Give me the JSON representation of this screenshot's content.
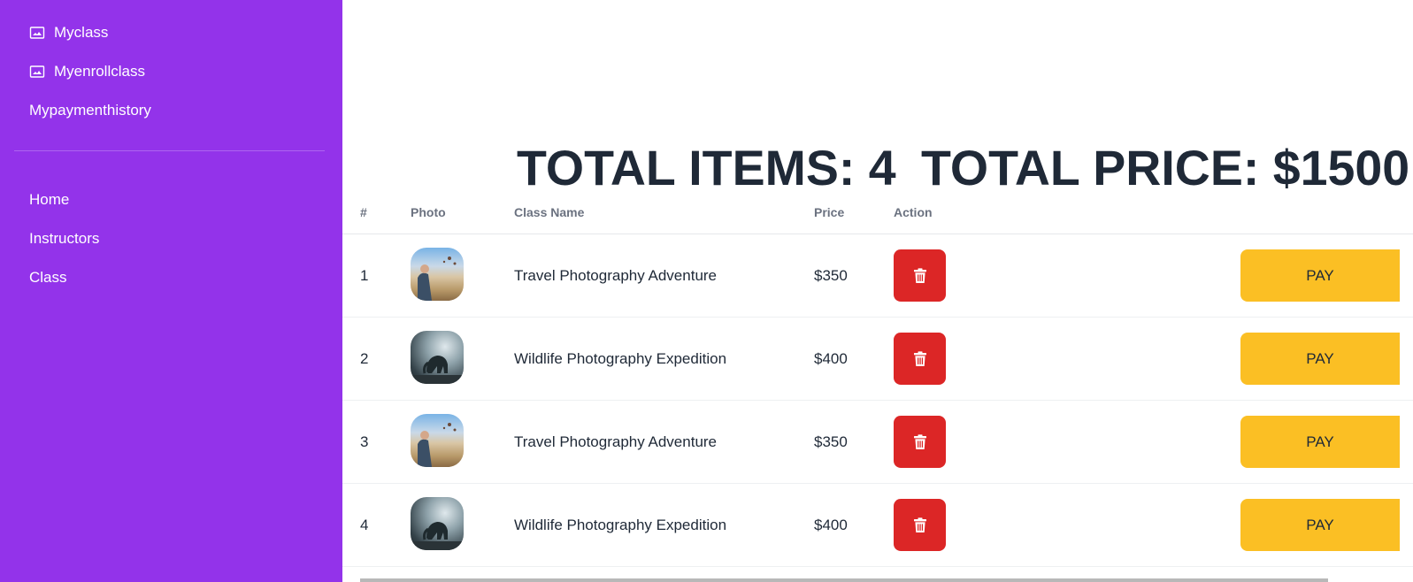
{
  "sidebar": {
    "top_items": [
      {
        "label": "Myclass",
        "icon": "image-icon"
      },
      {
        "label": "Myenrollclass",
        "icon": "image-icon"
      },
      {
        "label": "Mypaymenthistory",
        "icon": ""
      }
    ],
    "bottom_items": [
      {
        "label": "Home"
      },
      {
        "label": "Instructors"
      },
      {
        "label": "Class"
      }
    ],
    "background_color": "#9333ea"
  },
  "summary": {
    "total_items": "TOTAL ITEMS: 4",
    "total_price": "TOTAL PRICE: $1500"
  },
  "table": {
    "headers": {
      "num": "#",
      "photo": "Photo",
      "class_name": "Class Name",
      "price": "Price",
      "action": "Action"
    },
    "rows": [
      {
        "num": "1",
        "photo": "travel",
        "class_name": "Travel Photography Adventure",
        "price": "$350",
        "pay_label": "PAY"
      },
      {
        "num": "2",
        "photo": "wildlife",
        "class_name": "Wildlife Photography Expedition",
        "price": "$400",
        "pay_label": "PAY"
      },
      {
        "num": "3",
        "photo": "travel",
        "class_name": "Travel Photography Adventure",
        "price": "$350",
        "pay_label": "PAY"
      },
      {
        "num": "4",
        "photo": "wildlife",
        "class_name": "Wildlife Photography Expedition",
        "price": "$400",
        "pay_label": "PAY"
      }
    ]
  },
  "colors": {
    "delete": "#dc2626",
    "pay": "#fbbf24",
    "heading": "#1f2937"
  }
}
